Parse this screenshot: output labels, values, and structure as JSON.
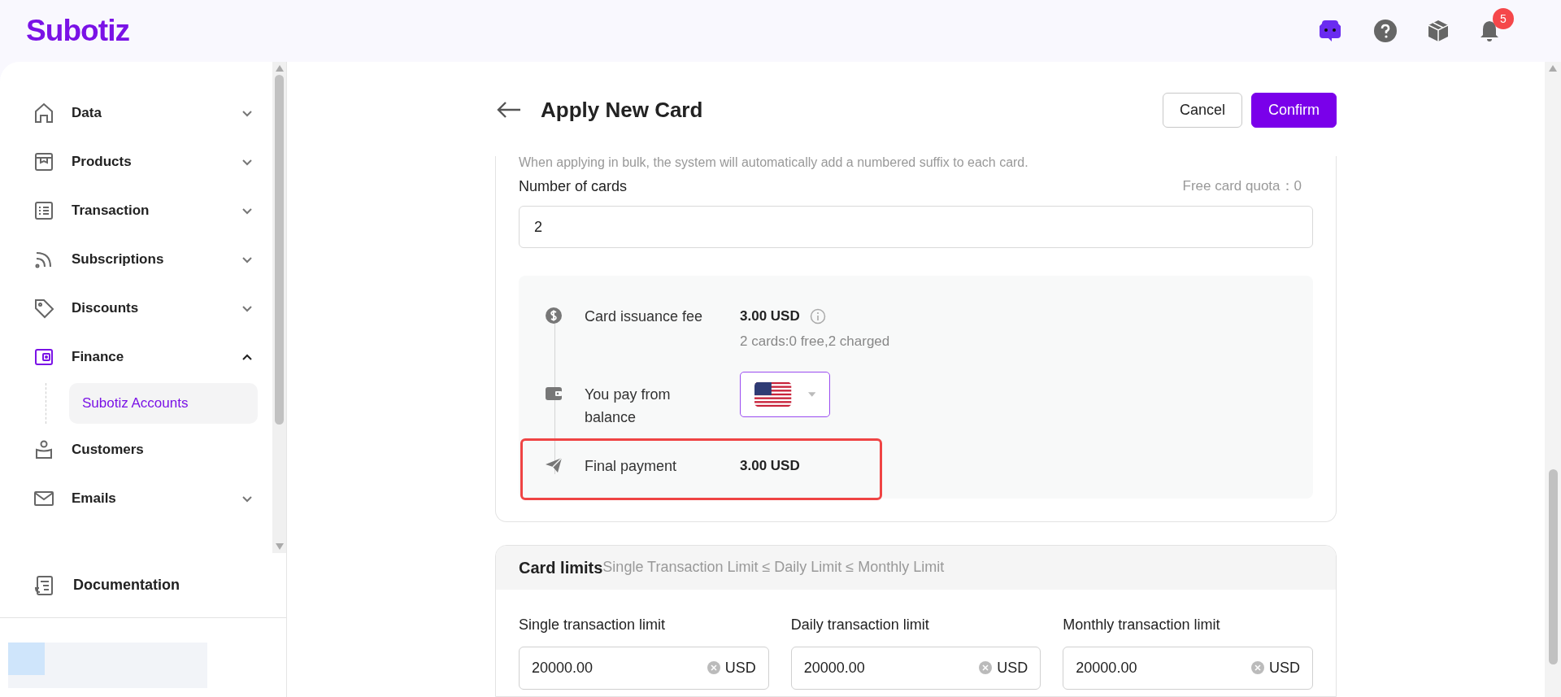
{
  "header": {
    "logo": "Subotiz",
    "notification_count": "5"
  },
  "sidebar": {
    "items": [
      {
        "label": "Data",
        "expanded": false,
        "selected": false
      },
      {
        "label": "Products",
        "expanded": false,
        "selected": false
      },
      {
        "label": "Transaction",
        "expanded": false,
        "selected": false
      },
      {
        "label": "Subscriptions",
        "expanded": false,
        "selected": false
      },
      {
        "label": "Discounts",
        "expanded": false,
        "selected": false
      },
      {
        "label": "Finance",
        "expanded": true,
        "selected": true,
        "children": [
          {
            "label": "Subotiz Accounts",
            "selected": true
          }
        ]
      },
      {
        "label": "Customers",
        "selected": false
      },
      {
        "label": "Emails",
        "expanded": false,
        "selected": false
      }
    ],
    "footer": {
      "label": "Documentation"
    }
  },
  "page": {
    "title": "Apply New Card",
    "buttons": [
      {
        "label": "Cancel",
        "kind": "secondary"
      },
      {
        "label": "Confirm",
        "kind": "primary"
      }
    ]
  },
  "card_form": {
    "hint": "When applying in bulk, the system will automatically add a numbered suffix to each card.",
    "number_field": {
      "label": "Number of cards",
      "quota": "Free card quota：0",
      "value": "2"
    },
    "payment_steps": [
      {
        "kind": "fee",
        "label": "Card issuance fee",
        "value": "3.00 USD",
        "note": "2 cards:0 free,2 charged",
        "highlighted": false
      },
      {
        "kind": "balance",
        "label": "You pay from balance",
        "highlighted": false
      },
      {
        "kind": "total",
        "label": "Final payment",
        "value": "3.00 USD",
        "highlighted": true
      }
    ]
  },
  "card_limits": {
    "title": "Card limits",
    "rule": "Single Transaction Limit ≤ Daily Limit ≤ Monthly Limit",
    "fields": [
      {
        "label": "Single transaction limit",
        "value": "20000.00",
        "unit": "USD"
      },
      {
        "label": "Daily transaction limit",
        "value": "20000.00",
        "unit": "USD"
      },
      {
        "label": "Monthly transaction limit",
        "value": "20000.00",
        "unit": "USD"
      }
    ]
  }
}
